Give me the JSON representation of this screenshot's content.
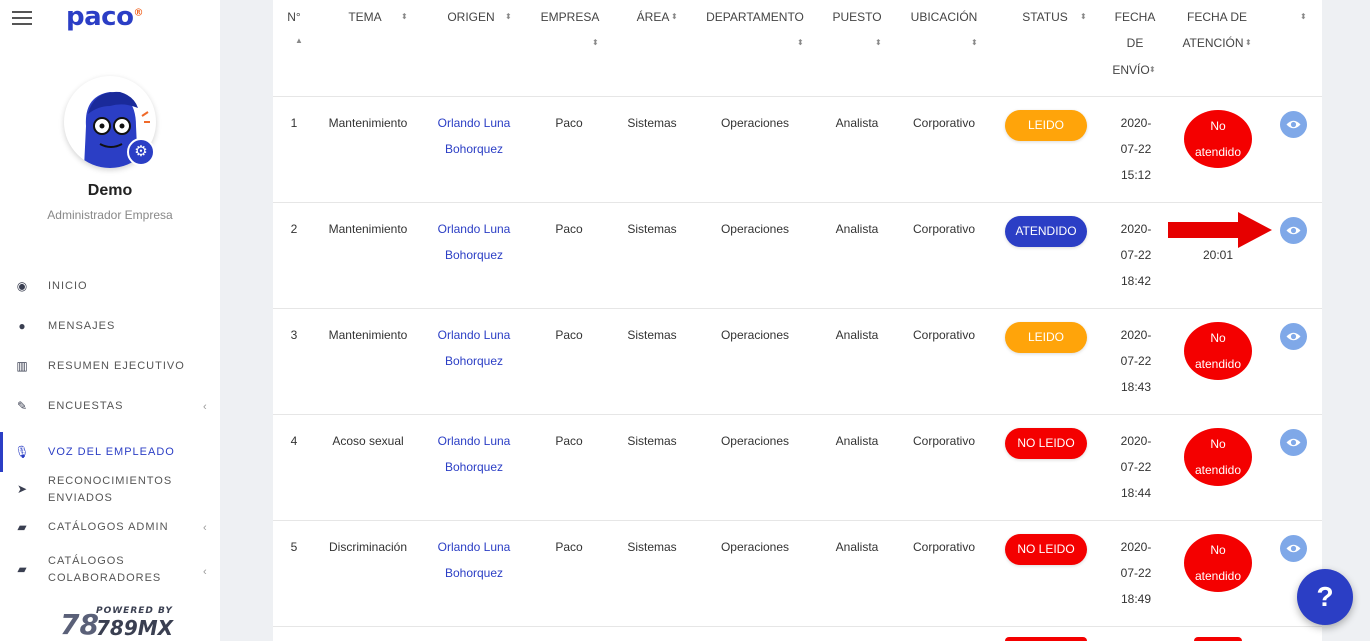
{
  "sidebar": {
    "logo": "paco",
    "logo_mark": "®",
    "user_name": "Demo",
    "user_role": "Administrador Empresa",
    "menu": [
      {
        "label": "INICIO",
        "icon": "dashboard-icon"
      },
      {
        "label": "MENSAJES",
        "icon": "chat-bubble-icon"
      },
      {
        "label": "RESUMEN EJECUTIVO",
        "icon": "bar-chart-icon"
      },
      {
        "label": "ENCUESTAS",
        "icon": "edit-icon"
      },
      {
        "label": "VOZ DEL EMPLEADO",
        "icon": "microphone-icon"
      },
      {
        "label": "RECONOCIMIENTOS",
        "label2": "ENVIADOS",
        "icon": "paper-plane-icon"
      },
      {
        "label": "CATÁLOGOS ADMIN",
        "icon": "book-icon"
      },
      {
        "label": "CATÁLOGOS",
        "label2": "COLABORADORES",
        "icon": "book-icon"
      }
    ],
    "powered_by": "POWERED BY",
    "powered_brand": "789MX",
    "powered_mark": "78"
  },
  "table": {
    "headers": {
      "n": "N°",
      "tema": "TEMA",
      "origen": "ORIGEN",
      "empresa": "EMPRESA",
      "area": "ÁREA",
      "departamento": "DEPARTAMENTO",
      "puesto": "PUESTO",
      "ubicacion": "UBICACIÓN",
      "status": "STATUS",
      "fecha_envio_1": "FECHA",
      "fecha_envio_2": "DE",
      "fecha_envio_3": "ENVÍO",
      "fecha_atencion_1": "FECHA DE",
      "fecha_atencion_2": "ATENCIÓN"
    },
    "rows": [
      {
        "n": "1",
        "tema": "Mantenimiento",
        "origen_1": "Orlando Luna",
        "origen_2": "Bohorquez",
        "empresa": "Paco",
        "area": "Sistemas",
        "departamento": "Operaciones",
        "puesto": "Analista",
        "ubicacion": "Corporativo",
        "status": "LEIDO",
        "fecha_1": "2020-",
        "fecha_2": "07-22",
        "fecha_3": "15:12",
        "atencion_1": "No",
        "atencion_2": "atendido"
      },
      {
        "n": "2",
        "tema": "Mantenimiento",
        "origen_1": "Orlando Luna",
        "origen_2": "Bohorquez",
        "empresa": "Paco",
        "area": "Sistemas",
        "departamento": "Operaciones",
        "puesto": "Analista",
        "ubicacion": "Corporativo",
        "status": "ATENDIDO",
        "fecha_1": "2020-",
        "fecha_2": "07-22",
        "fecha_3": "18:42",
        "atencion_1": "",
        "atencion_2": "20:01"
      },
      {
        "n": "3",
        "tema": "Mantenimiento",
        "origen_1": "Orlando Luna",
        "origen_2": "Bohorquez",
        "empresa": "Paco",
        "area": "Sistemas",
        "departamento": "Operaciones",
        "puesto": "Analista",
        "ubicacion": "Corporativo",
        "status": "LEIDO",
        "fecha_1": "2020-",
        "fecha_2": "07-22",
        "fecha_3": "18:43",
        "atencion_1": "No",
        "atencion_2": "atendido"
      },
      {
        "n": "4",
        "tema": "Acoso sexual",
        "origen_1": "Orlando Luna",
        "origen_2": "Bohorquez",
        "empresa": "Paco",
        "area": "Sistemas",
        "departamento": "Operaciones",
        "puesto": "Analista",
        "ubicacion": "Corporativo",
        "status": "NO LEIDO",
        "fecha_1": "2020-",
        "fecha_2": "07-22",
        "fecha_3": "18:44",
        "atencion_1": "No",
        "atencion_2": "atendido"
      },
      {
        "n": "5",
        "tema": "Discriminación",
        "origen_1": "Orlando Luna",
        "origen_2": "Bohorquez",
        "empresa": "Paco",
        "area": "Sistemas",
        "departamento": "Operaciones",
        "puesto": "Analista",
        "ubicacion": "Corporativo",
        "status": "NO LEIDO",
        "fecha_1": "2020-",
        "fecha_2": "07-22",
        "fecha_3": "18:49",
        "atencion_1": "No",
        "atencion_2": "atendido"
      }
    ]
  },
  "help_button": "?",
  "colors": {
    "brand": "#2b3ec5",
    "leido": "#ffa40a",
    "atendido": "#2b3ec5",
    "no_leido": "#f40000",
    "eye_button": "#7fa8e8",
    "annotation_arrow": "#e60000"
  }
}
